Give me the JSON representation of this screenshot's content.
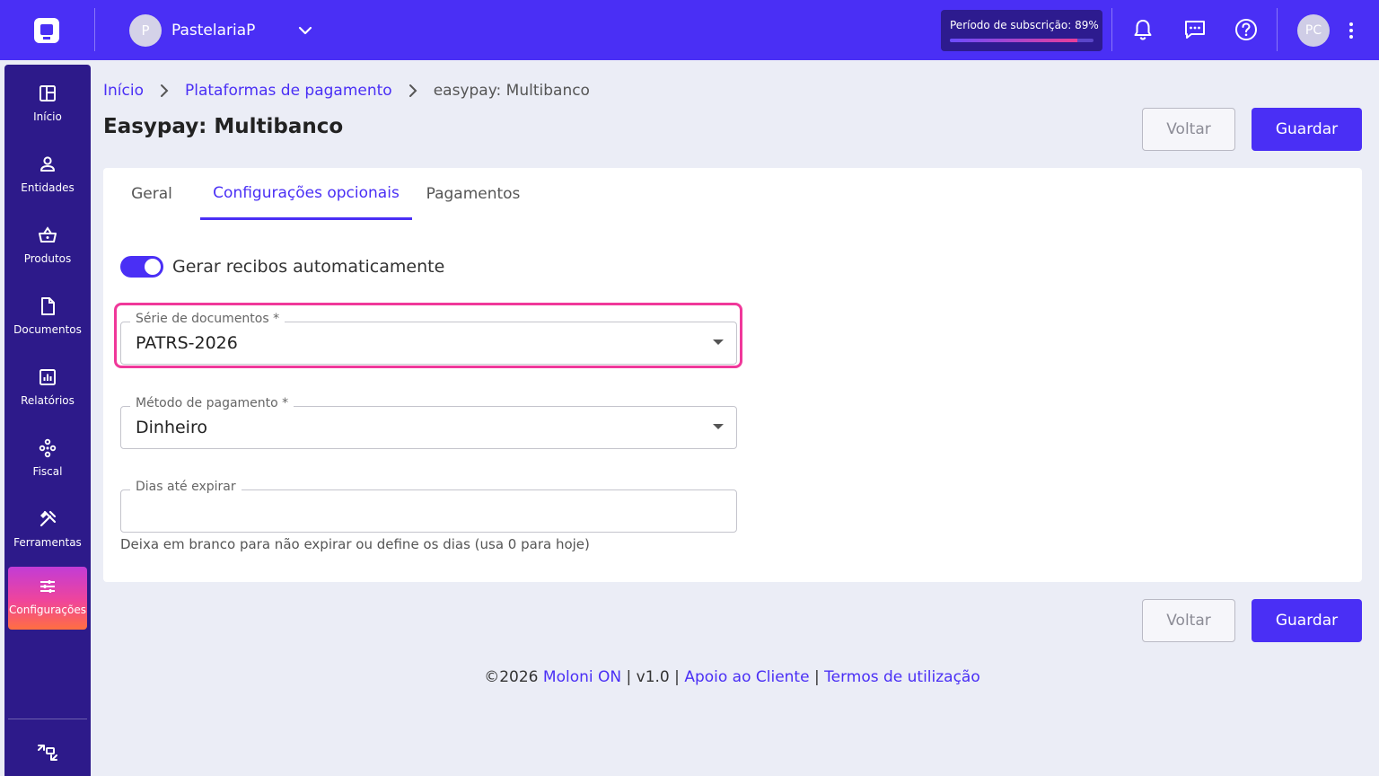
{
  "topbar": {
    "company_initial": "P",
    "company_name": "PastelariaP",
    "subscription_label": "Período de subscrição: 89%",
    "subscription_progress": 0.89,
    "user_initials": "PC",
    "icons": [
      "moloni-logo-icon",
      "chevron-down-icon",
      "bell-icon",
      "chat-icon",
      "help-icon",
      "more-vertical-icon"
    ]
  },
  "sidebar": {
    "items": [
      {
        "label": "Início",
        "icon": "dashboard-icon"
      },
      {
        "label": "Entidades",
        "icon": "user-icon"
      },
      {
        "label": "Produtos",
        "icon": "basket-icon"
      },
      {
        "label": "Documentos",
        "icon": "document-icon"
      },
      {
        "label": "Relatórios",
        "icon": "chart-icon"
      },
      {
        "label": "Fiscal",
        "icon": "fiscal-icon"
      },
      {
        "label": "Ferramentas",
        "icon": "tools-icon"
      },
      {
        "label": "Configurações",
        "icon": "sliders-icon"
      }
    ],
    "active": "Configurações",
    "bottom_icon": "switch-icon"
  },
  "breadcrumb": {
    "items": [
      "Início",
      "Plataformas de pagamento",
      "easypay: Multibanco"
    ]
  },
  "page": {
    "title": "Easypay: Multibanco",
    "back_label": "Voltar",
    "save_label": "Guardar"
  },
  "tabs": {
    "items": [
      "Geral",
      "Configurações opcionais",
      "Pagamentos"
    ],
    "active": "Configurações opcionais"
  },
  "form": {
    "auto_receipts_label": "Gerar recibos automaticamente",
    "auto_receipts_on": true,
    "series": {
      "label": "Série de documentos *",
      "value": "PATRS-2026"
    },
    "payment_method": {
      "label": "Método de pagamento *",
      "value": "Dinheiro"
    },
    "expire_days": {
      "label": "Dias até expirar",
      "value": "",
      "hint": "Deixa em branco para não expirar ou define os dias (usa 0 para hoje)"
    }
  },
  "footer": {
    "copyright": "©2026",
    "brand": "Moloni ON",
    "version": "v1.0",
    "support": "Apoio ao Cliente",
    "terms": "Termos de utilização",
    "separator": "|"
  },
  "colors": {
    "primary": "#4a2ff5",
    "sidebar": "#2d1a8a",
    "highlight": "#f0389a"
  }
}
